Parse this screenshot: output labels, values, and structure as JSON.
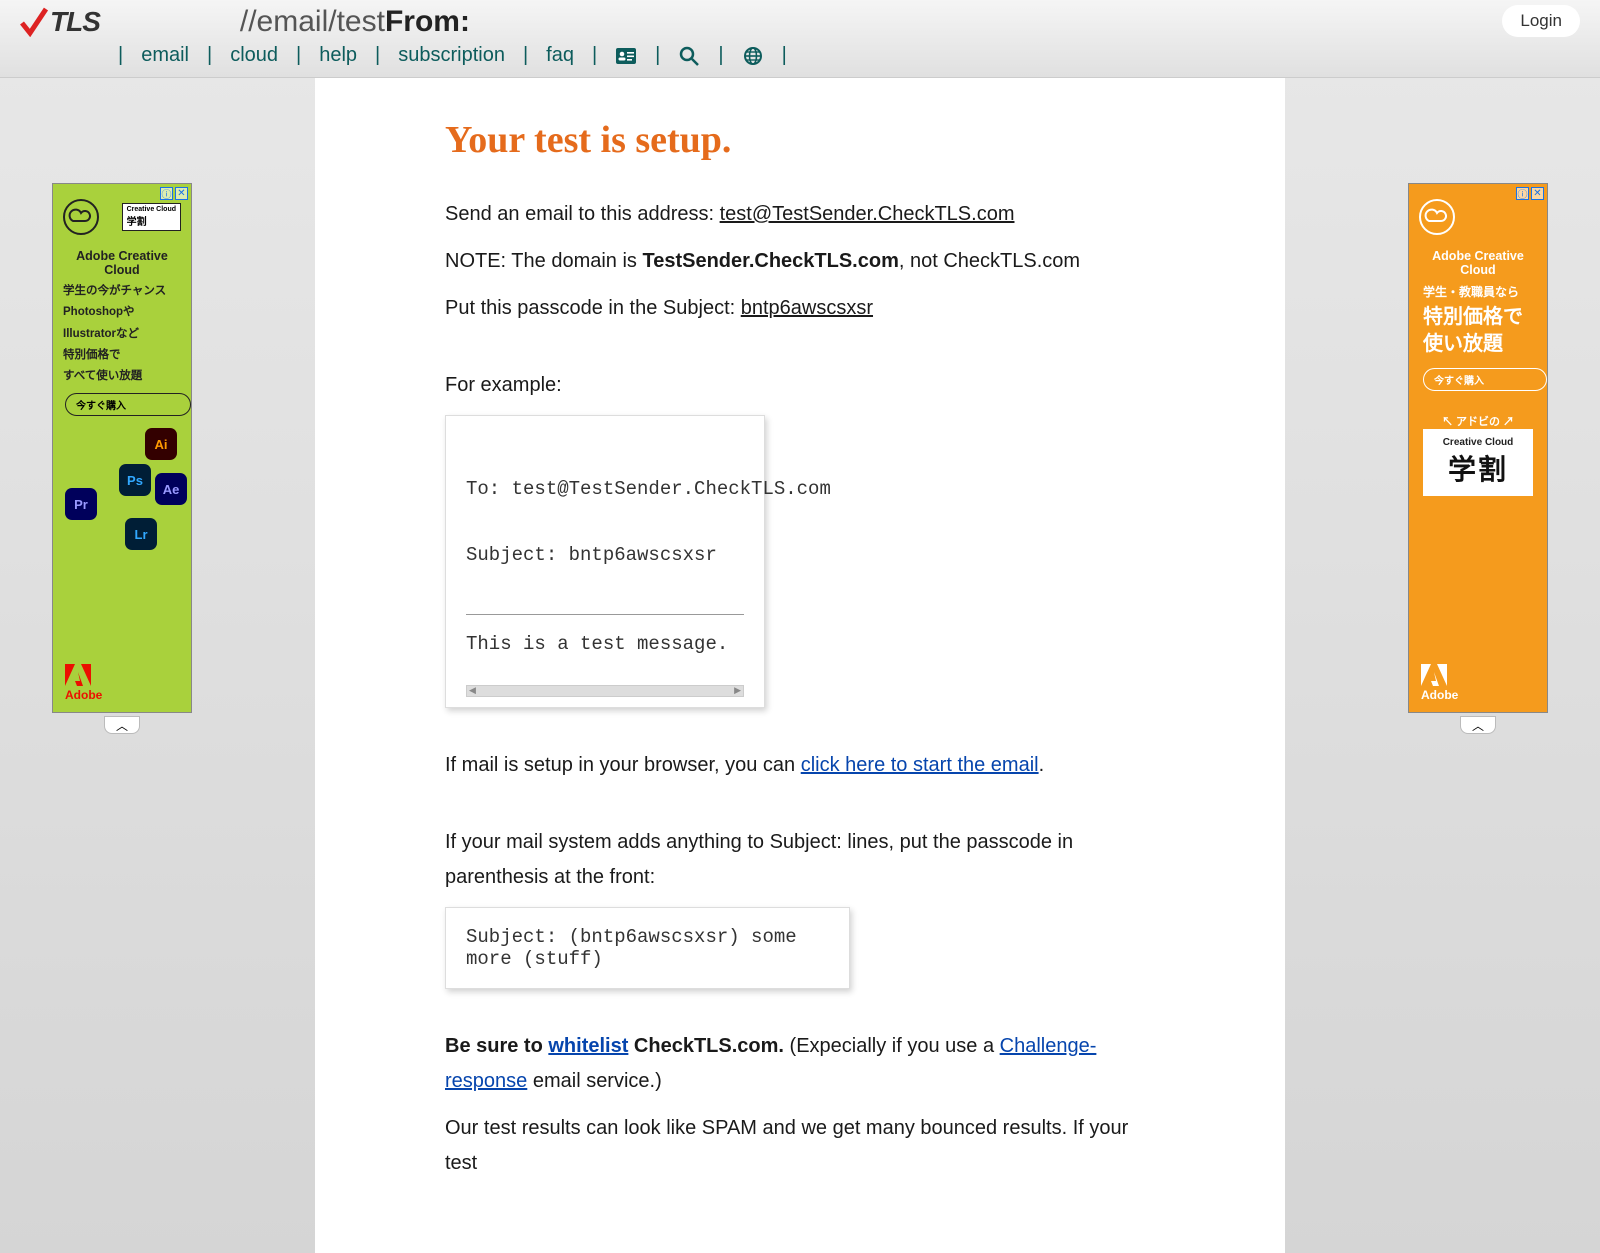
{
  "header": {
    "logo_text": "TLS",
    "path": "//email/test",
    "name": "From:",
    "login": "Login"
  },
  "nav": {
    "items": [
      "email",
      "cloud",
      "help",
      "subscription",
      "faq"
    ]
  },
  "content": {
    "heading": "Your test is setup.",
    "send_prefix": "Send an email to this address: ",
    "send_email": "test@TestSender.CheckTLS.com",
    "note_prefix": "NOTE: The domain is ",
    "note_domain": "TestSender.CheckTLS.com",
    "note_suffix": ", not CheckTLS.com",
    "passcode_prefix": "Put this passcode in the Subject: ",
    "passcode": "bntp6awscsxsr",
    "for_example": "For example:",
    "example": {
      "to": "To: test@TestSender.CheckTLS.com",
      "subject": "Subject: bntp6awscsxsr",
      "body": "This is a test message."
    },
    "mail_setup_prefix": "If mail is setup in your browser, you can ",
    "mail_setup_link": "click here to start the email",
    "mail_setup_suffix": ".",
    "subject_line_note": "If your mail system adds anything to Subject: lines, put the passcode in parenthesis at the front:",
    "subject_example": "Subject: (bntp6awscsxsr) some more (stuff)",
    "whitelist_prefix": "Be sure to ",
    "whitelist_link": "whitelist",
    "whitelist_suffix": " CheckTLS.com.",
    "whitelist_paren_prefix": " (Expecially if you use a ",
    "challenge_link": "Challenge-response",
    "whitelist_paren_suffix": " email service.)",
    "spam_note": "Our test results can look like SPAM and we get many bounced results. If your test"
  },
  "ads": {
    "left": {
      "title": "Adobe Creative Cloud",
      "line1": "学生の今がチャンス",
      "line2": "Photoshopや",
      "line3": "Illustratorなど",
      "line4": "特別価格で",
      "line5": "すべて使い放題",
      "button": "今すぐ購入",
      "box": "学割",
      "adobe": "Adobe"
    },
    "right": {
      "title": "Adobe Creative Cloud",
      "line1": "学生・教職員なら",
      "big1": "特別価格で",
      "big2": "使い放題",
      "button": "今すぐ購入",
      "box_top": "↖ アドビの ↗",
      "box_cc": "Creative Cloud",
      "box_big": "学割",
      "adobe": "Adobe"
    }
  }
}
